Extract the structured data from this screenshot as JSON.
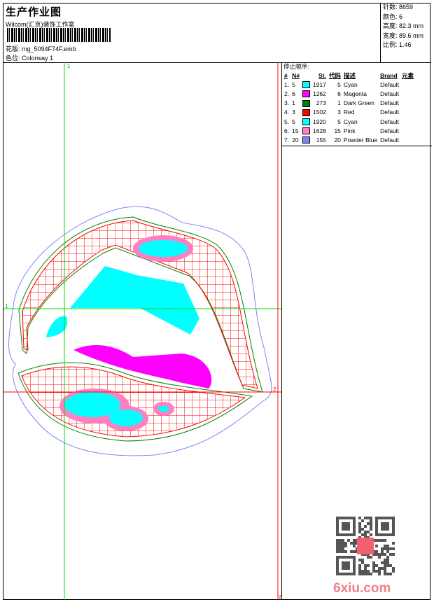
{
  "header": {
    "title": "生产作业图",
    "company": "Wilcom(汇京)装饰工作室",
    "design_label": "花版:",
    "design_file": "mg_5094F74F.emb",
    "colorway_label": "色位:",
    "colorway": "Colorway 1"
  },
  "info": {
    "stitches": "针数: 8659",
    "colors": "颜色: 6",
    "height": "高度: 82.3 mm",
    "width": "宽度: 89.6 mm",
    "scale": "比例: 1.46"
  },
  "stop_sequence": {
    "title": "停止顺序:",
    "columns": [
      "#",
      "N#",
      "St.",
      "代码",
      "描述",
      "Brand",
      "元素"
    ],
    "rows": [
      {
        "idx": "1.",
        "n": "5",
        "color": "#00ffff",
        "st": "1917",
        "code": "5",
        "desc": "Cyan",
        "brand": "Default"
      },
      {
        "idx": "2.",
        "n": "6",
        "color": "#ff00ff",
        "st": "1262",
        "code": "6",
        "desc": "Magenta",
        "brand": "Default"
      },
      {
        "idx": "3.",
        "n": "1",
        "color": "#008000",
        "st": "273",
        "code": "1",
        "desc": "Dark Green",
        "brand": "Default"
      },
      {
        "idx": "4.",
        "n": "3",
        "color": "#ff0000",
        "st": "1502",
        "code": "3",
        "desc": "Red",
        "brand": "Default"
      },
      {
        "idx": "5.",
        "n": "5",
        "color": "#00ffff",
        "st": "1920",
        "code": "5",
        "desc": "Cyan",
        "brand": "Default"
      },
      {
        "idx": "6.",
        "n": "15",
        "color": "#ff80c0",
        "st": "1628",
        "code": "15",
        "desc": "Pink",
        "brand": "Default"
      },
      {
        "idx": "7.",
        "n": "20",
        "color": "#8080ff",
        "st": "155",
        "code": "20",
        "desc": "Powder Blue",
        "brand": "Default"
      }
    ]
  },
  "guides": {
    "green_v": "1",
    "green_h": "1",
    "red_h": "2",
    "red_v": "2"
  },
  "watermark": "6xiu.com"
}
